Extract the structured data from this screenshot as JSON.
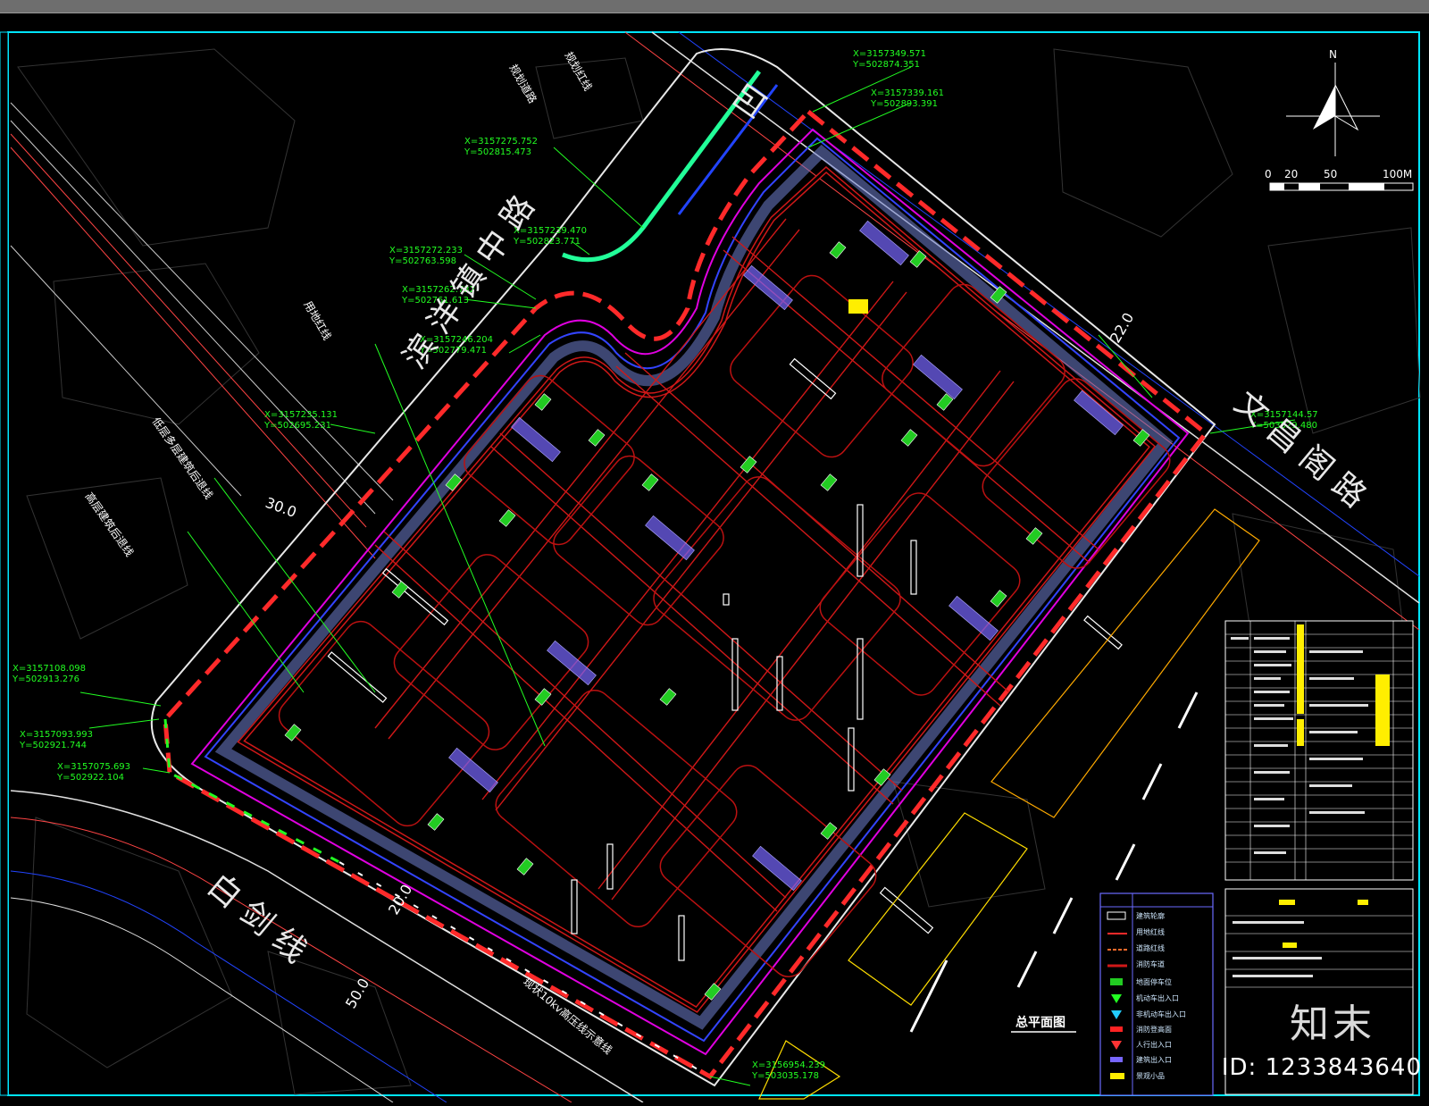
{
  "title_bar": "",
  "roads": {
    "north": "滨 洋 镇 中 路",
    "east": "文 昌 阁 路",
    "south": "白 剑 线",
    "top_label": "凹"
  },
  "road_widths": {
    "north": "22.0",
    "west": "30.0",
    "south_a": "20.0",
    "south_b": "50.0"
  },
  "coordinates": [
    {
      "x": "X=3157349.571",
      "y": "Y=502874.351"
    },
    {
      "x": "X=3157339.161",
      "y": "Y=502893.391"
    },
    {
      "x": "X=3157275.752",
      "y": "Y=502815.473"
    },
    {
      "x": "X=3157239.470",
      "y": "Y=502823.771"
    },
    {
      "x": "X=3157272.233",
      "y": "Y=502763.598"
    },
    {
      "x": "X=3157262.732",
      "y": "Y=502761.613"
    },
    {
      "x": "X=3157246.204",
      "y": "Y=502779.471"
    },
    {
      "x": "X=3157235.131",
      "y": "Y=502695.231"
    },
    {
      "x": "X=3157108.098",
      "y": "Y=502913.276"
    },
    {
      "x": "X=3157093.993",
      "y": "Y=502921.744"
    },
    {
      "x": "X=3157075.693",
      "y": "Y=502922.104"
    },
    {
      "x": "X=3156954.239",
      "y": "Y=503035.178"
    },
    {
      "x": "X=3157144.57",
      "y": "Y=503029.480"
    }
  ],
  "annotations": {
    "setback_west": "用地红线",
    "setback_low": "低层多层建筑后退线",
    "setback_high": "高层建筑后退线",
    "power_line": "现状10kv高压线示意线",
    "plan_title": "总平面图",
    "planned_road": "规划道路",
    "planned_line": "规划红线"
  },
  "north_arrow": {
    "letter": "N",
    "scale_labels": [
      "0",
      "20",
      "50",
      "100M"
    ]
  },
  "legend": {
    "items": [
      {
        "label": "建筑轮廓"
      },
      {
        "label": "用地红线"
      },
      {
        "label": "道路红线"
      },
      {
        "label": "消防车道"
      },
      {
        "label": "地面停车位"
      },
      {
        "label": "机动车出入口"
      },
      {
        "label": "非机动车出入口"
      },
      {
        "label": "消防登高面"
      },
      {
        "label": "人行出入口"
      },
      {
        "label": "建筑出入口"
      },
      {
        "label": "景观小品"
      }
    ]
  },
  "watermark": {
    "brand": "知末",
    "id": "ID: 1233843640"
  },
  "colors": {
    "background": "#000000",
    "frame": "#00e5ff",
    "property_line": "#ff2a2a",
    "coord_text": "#22ff22",
    "fire_lane": "#d01818",
    "magenta": "#e000e0",
    "blue": "#2233ff",
    "highlight": "#ffee00"
  }
}
